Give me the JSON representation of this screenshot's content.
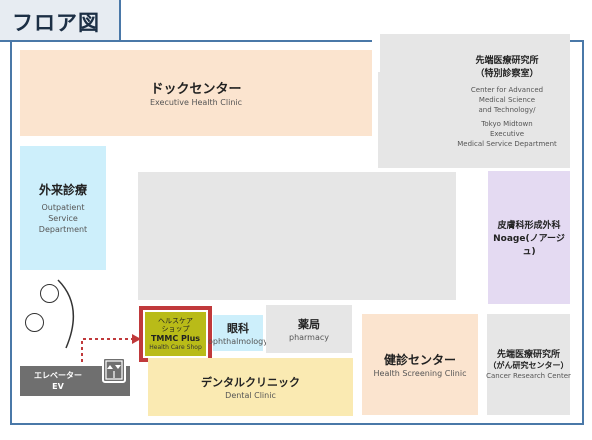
{
  "title": "フロア図",
  "rooms": {
    "dock": {
      "jp": "ドックセンター",
      "en": "Executive Health Clinic"
    },
    "advanced": {
      "jp1": "先端医療研究所",
      "jp2": "（特別診察室）",
      "en": [
        "Center for Advanced",
        "Medical Science",
        "and Technology/",
        "Tokyo Midtown",
        "Executive",
        "Medical Service Department"
      ]
    },
    "outpatient": {
      "jp": "外来診療",
      "en": [
        "Outpatient",
        "Service",
        "Department"
      ]
    },
    "derm": {
      "jp1": "皮膚科形成外科",
      "jp2": "Noage(ノアージュ)"
    },
    "shop": {
      "jp1": "ヘルスケア",
      "jp2": "ショップ",
      "brand": "TMMC Plus",
      "en": "Health Care Shop"
    },
    "ophth": {
      "jp": "眼科",
      "en": "ophthalmology"
    },
    "pharmacy": {
      "jp": "薬局",
      "en": "pharmacy"
    },
    "screening": {
      "jp": "健診センター",
      "en": "Health Screening Clinic"
    },
    "cancer": {
      "jp1": "先端医療研究所",
      "jp2": "（がん研究センター）",
      "en": "Cancer Research Center"
    },
    "dental": {
      "jp": "デンタルクリニック",
      "en": "Dental Clinic"
    },
    "elevator": {
      "jp": "エレベーター",
      "en": "EV"
    }
  },
  "colors": {
    "border": "#4a78a8",
    "highlight": "#c0393b",
    "shop": "#b9bb18"
  }
}
